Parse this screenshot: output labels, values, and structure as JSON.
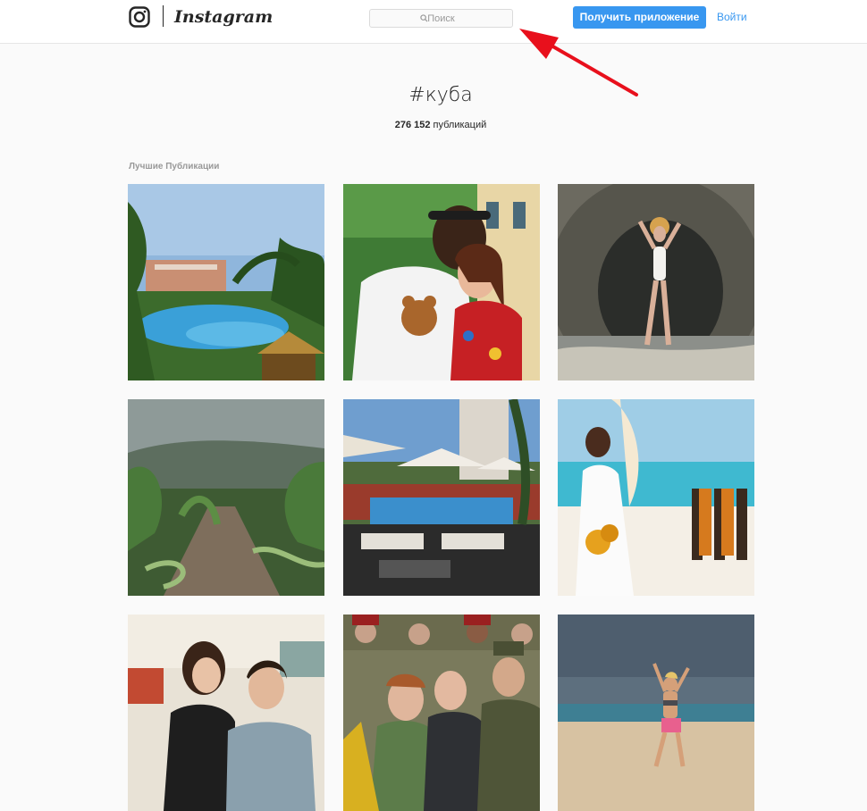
{
  "header": {
    "logo_text": "Instagram",
    "search": {
      "placeholder": "Поиск",
      "value": ""
    },
    "get_app_label": "Получить приложение",
    "login_label": "Войти"
  },
  "tag": {
    "name": "#куба",
    "count": "276 152",
    "count_suffix": "публикаций"
  },
  "section": {
    "top_posts_label": "Лучшие Публикации"
  },
  "colors": {
    "accent": "#3897f0",
    "annotation_arrow": "#e8101c"
  },
  "posts": [
    {
      "subject": "resort-pool-palms"
    },
    {
      "subject": "couple-olympic-bear-tshirt"
    },
    {
      "subject": "woman-in-sea-cave"
    },
    {
      "subject": "banana-plantation-storm"
    },
    {
      "subject": "poolside-umbrellas"
    },
    {
      "subject": "bride-on-beach"
    },
    {
      "subject": "couple-in-car"
    },
    {
      "subject": "crowd-with-leaders"
    },
    {
      "subject": "woman-on-beach-storm"
    }
  ]
}
